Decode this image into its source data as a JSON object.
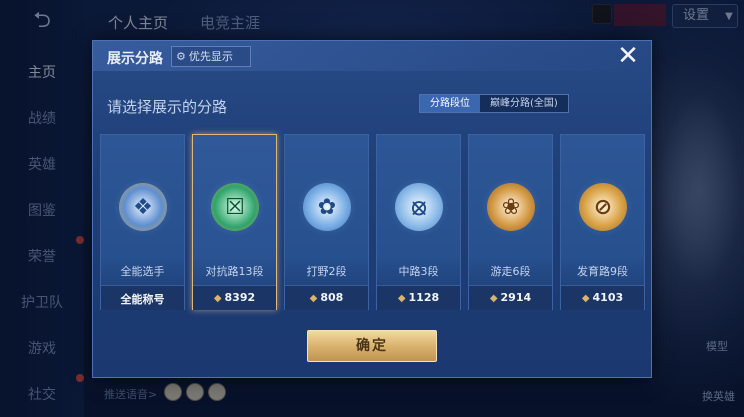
{
  "background": {
    "sidebar": {
      "back_icon": "back-arrow-icon",
      "items": [
        {
          "label": "主页",
          "active": true
        },
        {
          "label": "战绩"
        },
        {
          "label": "英雄"
        },
        {
          "label": "图鉴"
        },
        {
          "label": "荣誉"
        },
        {
          "label": "护卫队"
        },
        {
          "label": "游戏"
        },
        {
          "label": "社交"
        }
      ]
    },
    "top_tabs": [
      {
        "label": "个人主页",
        "active": true
      },
      {
        "label": "电竞主涯"
      }
    ],
    "settings_label": "设置",
    "notice_text": "",
    "bottom_hint": "推送语音>",
    "right_labels": {
      "top": "模型",
      "bottom": "换英雄"
    }
  },
  "modal": {
    "title": "展示分路",
    "priority_label": "优先显示",
    "close_icon": "close-icon",
    "subtitle": "请选择展示的分路",
    "segments": [
      {
        "label": "分路段位",
        "active": true
      },
      {
        "label": "巅峰分路(全国)",
        "active": false
      }
    ],
    "cards": [
      {
        "name": "全能选手",
        "value": "全能称号",
        "selected": false,
        "color": "#c9a24f",
        "show_points": false
      },
      {
        "name": "对抗路13段",
        "value": "8392",
        "selected": true,
        "color": "#2fa36b",
        "show_points": true
      },
      {
        "name": "打野2段",
        "value": "808",
        "selected": false,
        "color": "#4c8fd6",
        "show_points": true
      },
      {
        "name": "中路3段",
        "value": "1128",
        "selected": false,
        "color": "#6aa7e8",
        "show_points": true
      },
      {
        "name": "游走6段",
        "value": "2914",
        "selected": false,
        "color": "#d49a45",
        "show_points": true
      },
      {
        "name": "发育路9段",
        "value": "4103",
        "selected": false,
        "color": "#d9a347",
        "show_points": true
      }
    ],
    "confirm_label": "确定"
  },
  "colors": {
    "accent_gold": "#d9b36e",
    "modal_bg": "#274a86",
    "segment_active": "#3b66b0"
  }
}
